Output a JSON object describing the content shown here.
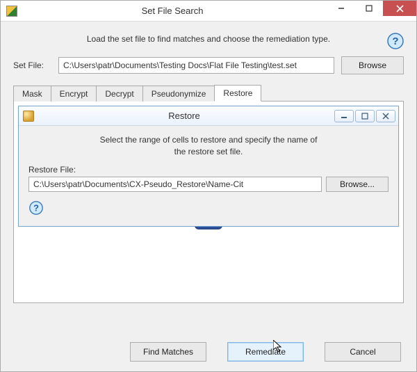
{
  "window": {
    "title": "Set File Search"
  },
  "intro": "Load the set file to find matches and choose the remediation type.",
  "setfile": {
    "label": "Set File:",
    "value": "C:\\Users\\patr\\Documents\\Testing Docs\\Flat File Testing\\test.set",
    "browse": "Browse"
  },
  "tabs": {
    "mask": "Mask",
    "encrypt": "Encrypt",
    "decrypt": "Decrypt",
    "pseudonymize": "Pseudonymize",
    "restore": "Restore"
  },
  "restore_panel": {
    "title": "Restore",
    "desc_line1": "Select the range of cells to restore and specify the name of",
    "desc_line2": "the restore set file.",
    "file_label": "Restore File:",
    "file_value": "C:\\Users\\patr\\Documents\\CX-Pseudo_Restore\\Name-Cit",
    "browse": "Browse..."
  },
  "footer": {
    "find": "Find Matches",
    "remediate": "Remediate",
    "cancel": "Cancel"
  }
}
